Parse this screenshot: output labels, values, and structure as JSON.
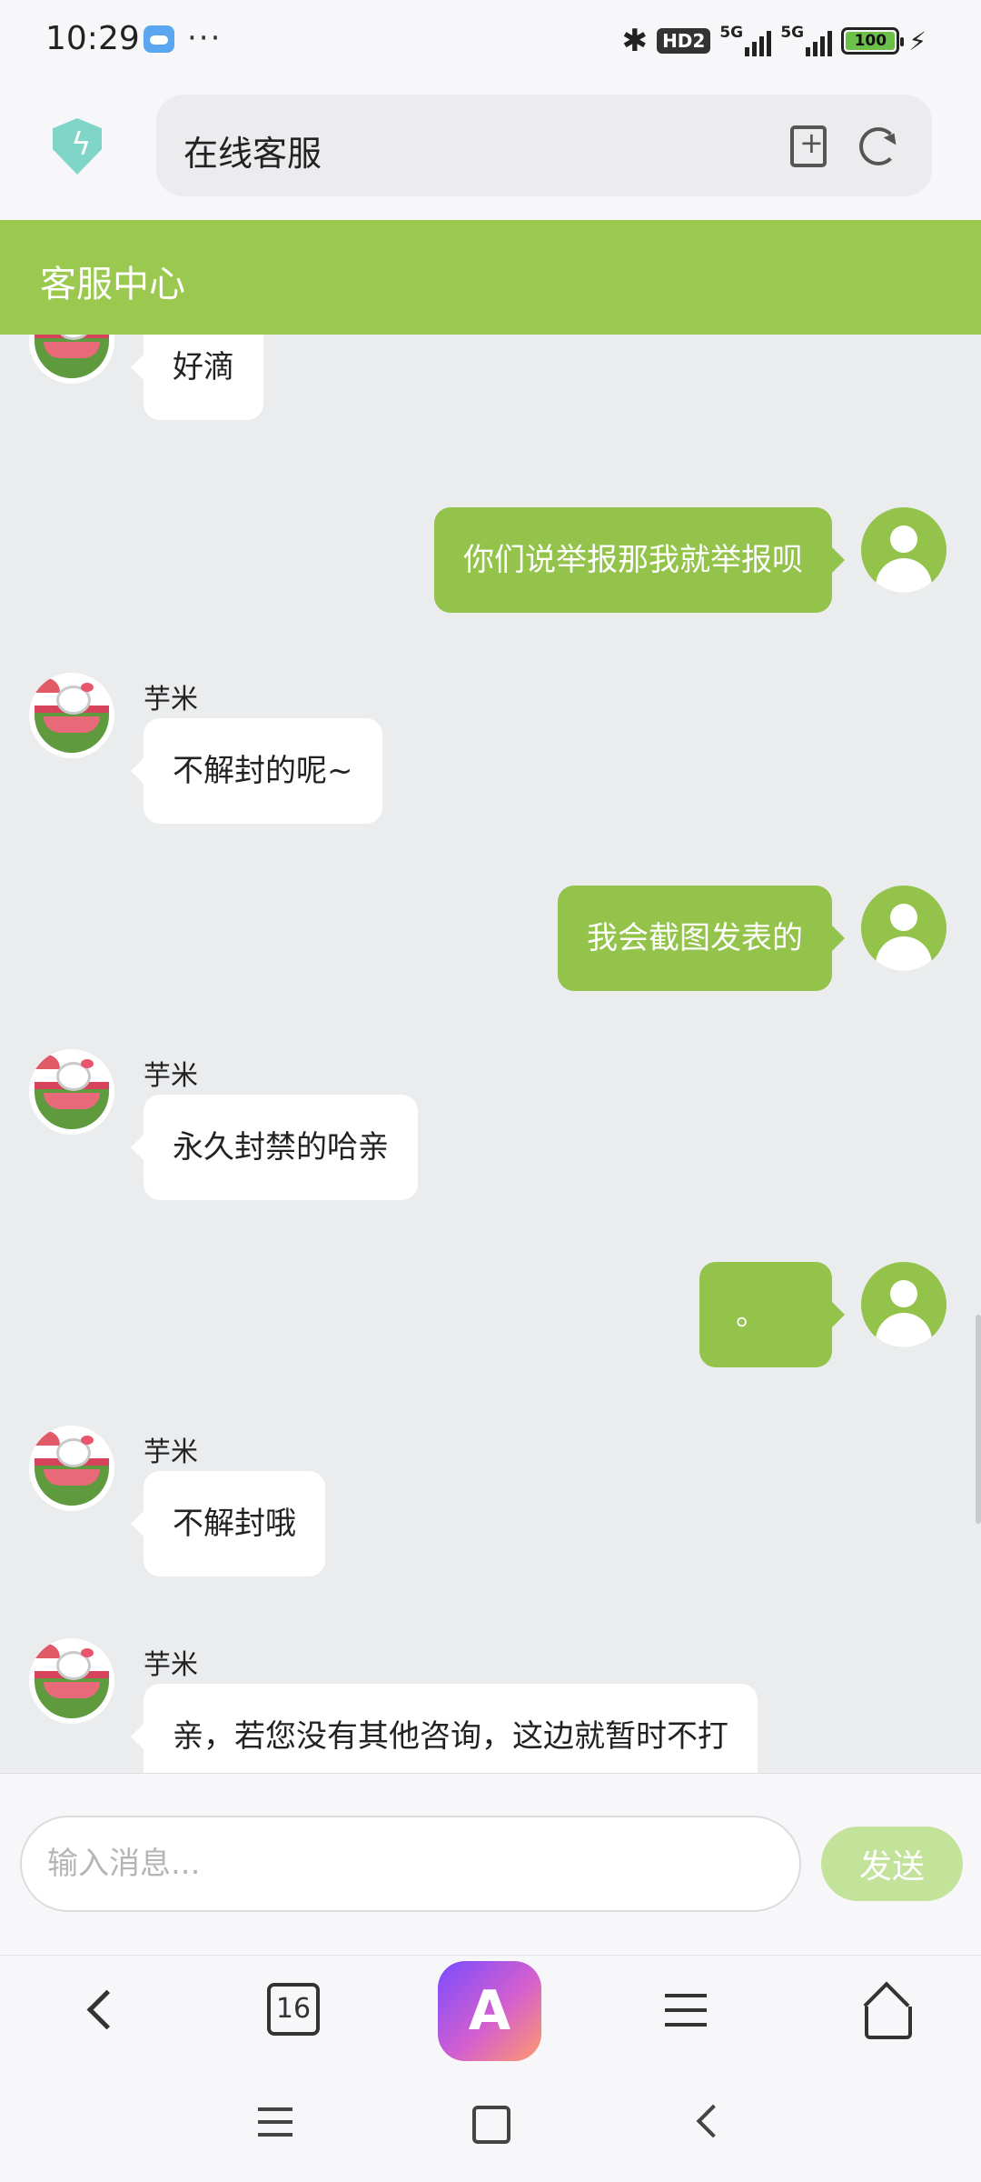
{
  "status_bar": {
    "time": "10:29",
    "dots": "···",
    "bluetooth_icon": "bluetooth-icon",
    "hd_badge": "HD2",
    "network_1": "5G",
    "network_2": "5G",
    "battery_level": "100"
  },
  "browser": {
    "url_text": "在线客服",
    "security_icon": "shield-bolt-icon",
    "bookmark_icon": "bookmark-add-icon",
    "reload_icon": "reload-icon"
  },
  "header": {
    "title": "客服中心",
    "color": "#9bc84f"
  },
  "messages": [
    {
      "side": "bot",
      "sender": "",
      "text": "好滴"
    },
    {
      "side": "user",
      "text": "你们说举报那我就举报呗"
    },
    {
      "side": "bot",
      "sender": "芋米",
      "text": "不解封的呢~"
    },
    {
      "side": "user",
      "text": "我会截图发表的"
    },
    {
      "side": "bot",
      "sender": "芋米",
      "text": "永久封禁的哈亲"
    },
    {
      "side": "user",
      "text": "。"
    },
    {
      "side": "bot",
      "sender": "芋米",
      "text": "不解封哦"
    },
    {
      "side": "bot",
      "sender": "芋米",
      "text": "亲，若您没有其他咨询，这边就暂时不打"
    }
  ],
  "input": {
    "placeholder": "输入消息...",
    "send_label": "发送"
  },
  "browser_nav": {
    "tab_count": "16",
    "ai_label": "A"
  },
  "colors": {
    "accent_green": "#93c34a",
    "send_disabled": "#c3e29a",
    "chat_background": "#ebecee"
  }
}
